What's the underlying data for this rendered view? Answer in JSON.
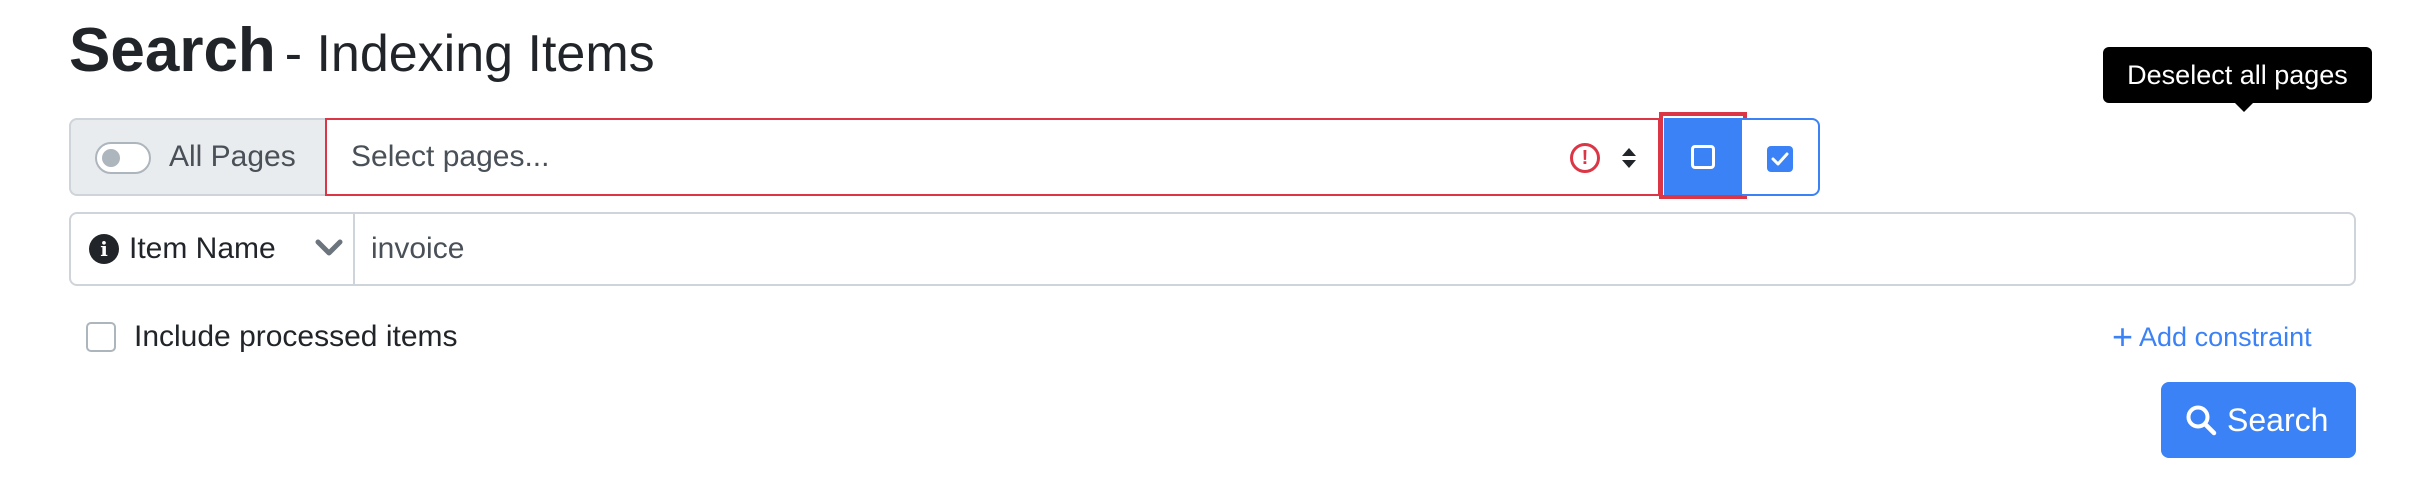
{
  "header": {
    "title": "Search",
    "subtitle": "- Indexing Items"
  },
  "pages_filter": {
    "all_pages_label": "All Pages",
    "all_pages_enabled": false,
    "select_placeholder": "Select pages...",
    "deselect_tooltip": "Deselect all pages"
  },
  "constraint": {
    "field_label": "Item Name",
    "value": "invoice"
  },
  "options": {
    "include_processed_label": "Include processed items",
    "include_processed_checked": false,
    "add_constraint_label": "Add constraint"
  },
  "actions": {
    "search_label": "Search"
  },
  "colors": {
    "primary": "#3b82f6",
    "danger": "#dc3545",
    "tooltip_bg": "#000000"
  }
}
